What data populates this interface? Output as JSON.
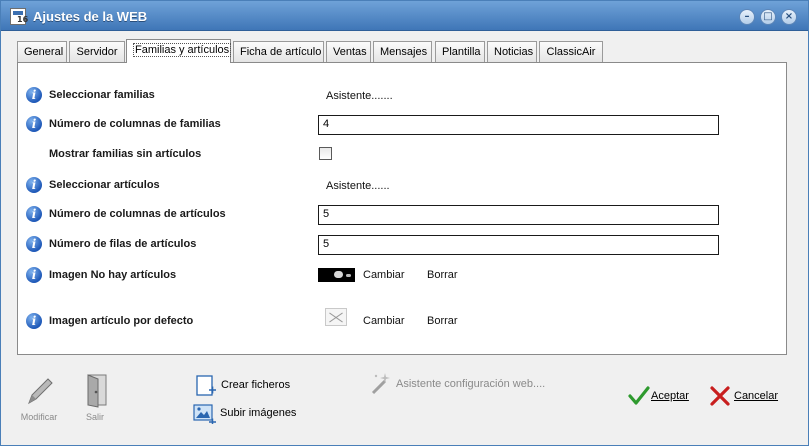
{
  "window": {
    "title": "Ajustes de la WEB",
    "controls": {
      "minimize": "–",
      "maximize": "□",
      "close": "×"
    }
  },
  "tabs": [
    {
      "label": "General"
    },
    {
      "label": "Servidor"
    },
    {
      "label": "Familias y artículos",
      "active": true
    },
    {
      "label": "Ficha de artículo"
    },
    {
      "label": "Ventas"
    },
    {
      "label": "Mensajes"
    },
    {
      "label": "Plantilla"
    },
    {
      "label": "Noticias"
    },
    {
      "label": "ClassicAir"
    }
  ],
  "fields": {
    "select_families": {
      "label": "Seleccionar familias",
      "action": "Asistente......."
    },
    "family_columns": {
      "label": "Número de columnas de familias",
      "value": "4"
    },
    "show_empty_families": {
      "label": "Mostrar familias sin artículos",
      "checked": false
    },
    "select_articles": {
      "label": "Seleccionar artículos",
      "action": "Asistente......"
    },
    "article_columns": {
      "label": "Número de columnas de artículos",
      "value": "5"
    },
    "article_rows": {
      "label": "Número de filas de artículos",
      "value": "5"
    },
    "no_articles_image": {
      "label": "Imagen No hay artículos",
      "change": "Cambiar",
      "delete": "Borrar"
    },
    "default_article_image": {
      "label": "Imagen artículo por defecto",
      "change": "Cambiar",
      "delete": "Borrar"
    }
  },
  "toolbar": {
    "modify": "Modificar",
    "exit": "Salir",
    "create_files": "Crear ficheros",
    "upload_images": "Subir imágenes",
    "web_wizard": "Asistente configuración web....",
    "accept": "Aceptar",
    "cancel": "Cancelar"
  },
  "icons": {
    "info": "info-icon",
    "pen": "pen-icon",
    "door": "door-icon",
    "new_file": "new-file-icon",
    "image_upload": "image-upload-icon",
    "wand": "magic-wand-icon",
    "check": "check-icon",
    "cross": "cross-icon"
  },
  "colors": {
    "title_bar": "#3f76b7",
    "info": "#1f59b8",
    "accept": "#2e9a2e",
    "cancel": "#c81e1e"
  }
}
